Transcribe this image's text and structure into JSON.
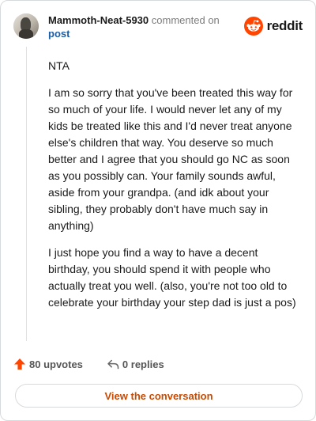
{
  "header": {
    "username": "Mammoth-Neat-5930",
    "action_text": "commented on",
    "target": "post",
    "brand": "reddit"
  },
  "comment": {
    "paragraphs": [
      "NTA",
      "I am so sorry that you've been treated this way for so much of your life. I would never let any of my kids be treated like this and I'd never treat anyone else's children that way. You deserve so much better and I agree that you should go NC as soon as you possibly can. Your family sounds awful, aside from your grandpa. (and idk about your sibling, they probably don't have much say in anything)",
      "I just hope you find a way to have a decent birthday, you should spend it with people who actually treat you well. (also, you're not too old to celebrate your birthday your step dad is just a pos)"
    ]
  },
  "footer": {
    "upvotes": "80 upvotes",
    "replies": "0 replies",
    "cta": "View the conversation"
  },
  "icons": {
    "avatar": "user-avatar",
    "logo": "reddit-logo-icon",
    "upvote": "upvote-arrow-icon",
    "reply": "reply-arrow-icon"
  },
  "colors": {
    "brand": "#ff4500",
    "upvote": "#ff4500",
    "link": "#1a5fa6",
    "cta": "#c94a00",
    "border": "#d7dadc"
  }
}
